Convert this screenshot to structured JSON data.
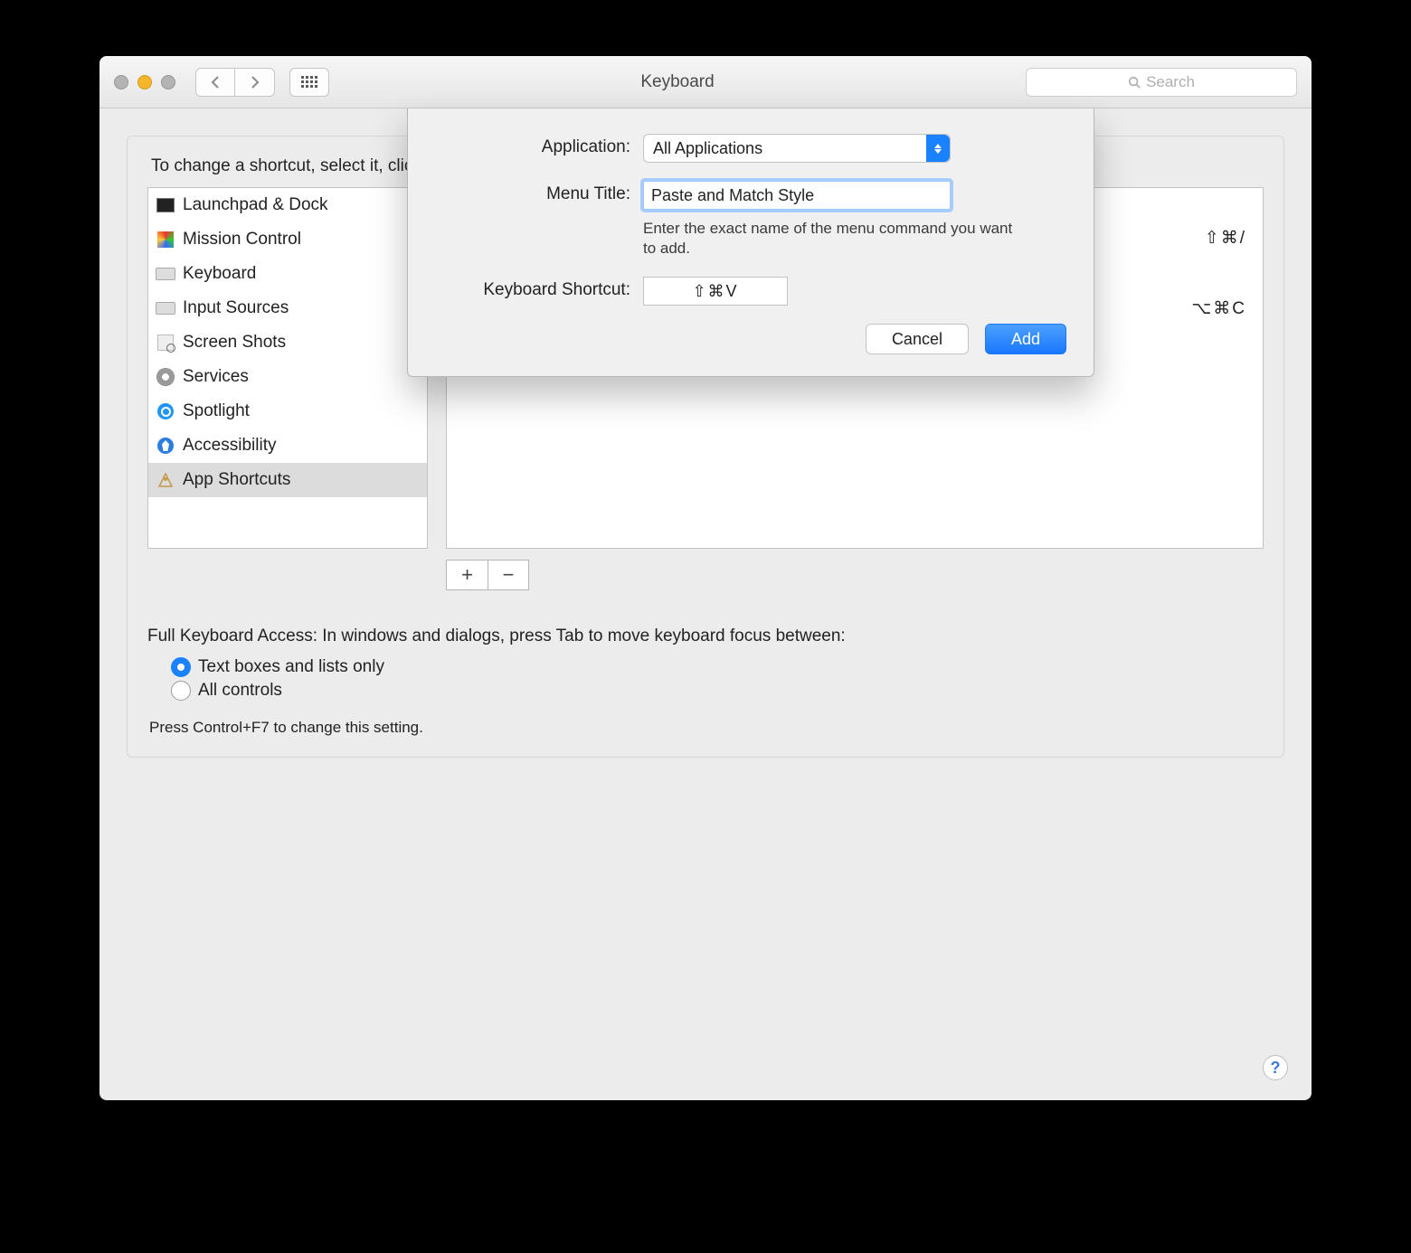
{
  "window": {
    "title": "Keyboard"
  },
  "search": {
    "placeholder": "Search"
  },
  "hint": "To change a shortcut, select it, click the key combination, and then type the new keys.",
  "categories": [
    {
      "label": "Launchpad & Dock",
      "icon": "launchpad-icon"
    },
    {
      "label": "Mission Control",
      "icon": "mission-control-icon"
    },
    {
      "label": "Keyboard",
      "icon": "keyboard-icon"
    },
    {
      "label": "Input Sources",
      "icon": "keyboard-icon"
    },
    {
      "label": "Screen Shots",
      "icon": "screenshot-icon"
    },
    {
      "label": "Services",
      "icon": "gear-icon"
    },
    {
      "label": "Spotlight",
      "icon": "spotlight-icon"
    },
    {
      "label": "Accessibility",
      "icon": "accessibility-icon"
    },
    {
      "label": "App Shortcuts",
      "icon": "app-shortcuts-icon",
      "selected": true
    }
  ],
  "shortcuts": [
    {
      "keys": "⇧⌘/"
    },
    {
      "keys": "⌥⌘C"
    }
  ],
  "plusminus": {
    "add": "+",
    "remove": "−"
  },
  "fka": {
    "intro": "Full Keyboard Access: In windows and dialogs, press Tab to move keyboard focus between:",
    "opt1": "Text boxes and lists only",
    "opt2": "All controls",
    "note": "Press Control+F7 to change this setting."
  },
  "help": "?",
  "sheet": {
    "appLabel": "Application:",
    "appValue": "All Applications",
    "menuLabel": "Menu Title:",
    "menuValue": "Paste and Match Style",
    "menuHelp": "Enter the exact name of the menu command you want to add.",
    "kbdLabel": "Keyboard Shortcut:",
    "kbdValue": "⇧⌘V",
    "cancel": "Cancel",
    "add": "Add"
  }
}
